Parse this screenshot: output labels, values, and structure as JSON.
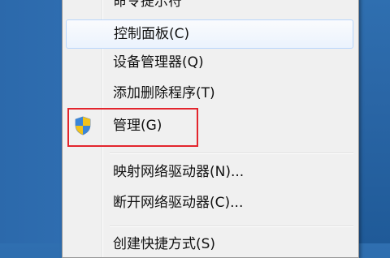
{
  "context_menu": {
    "items": [
      {
        "label": "命令提示符"
      },
      {
        "label": "控制面板(C)"
      },
      {
        "label": "设备管理器(Q)"
      },
      {
        "label": "添加删除程序(T)"
      },
      {
        "label": "管理(G)",
        "icon": "uac-shield-icon"
      },
      {
        "label": "映射网络驱动器(N)..."
      },
      {
        "label": "断开网络驱动器(C)..."
      },
      {
        "label": "创建快捷方式(S)"
      }
    ]
  },
  "colors": {
    "highlight_border": "#e3252d",
    "hover_border": "#b8d6fb",
    "desktop": "#2a66a6"
  }
}
